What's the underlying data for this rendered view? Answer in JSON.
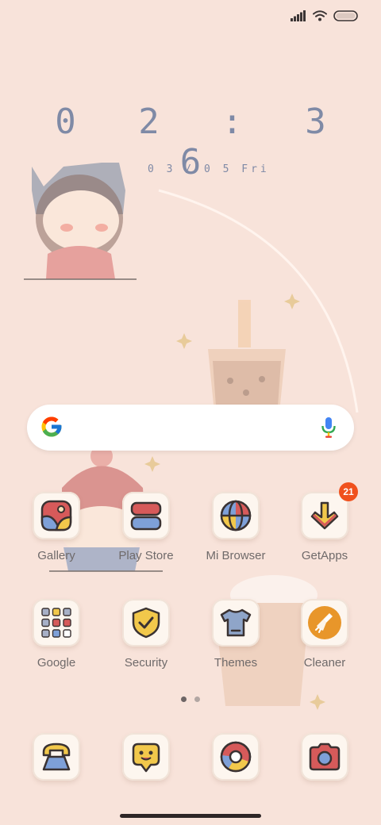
{
  "clock": {
    "time": "0 2 : 3 6",
    "date": "0 3 / 0 5  Fri"
  },
  "status": {
    "signal_icon": "signal-icon",
    "wifi_icon": "wifi-icon",
    "battery_icon": "battery-icon"
  },
  "search": {
    "logo_icon": "google-g-icon",
    "mic_icon": "mic-icon"
  },
  "apps_row1": [
    {
      "label": "Gallery",
      "icon": "gallery-icon"
    },
    {
      "label": "Play Store",
      "icon": "play-store-icon"
    },
    {
      "label": "Mi Browser",
      "icon": "browser-icon"
    },
    {
      "label": "GetApps",
      "icon": "getapps-icon",
      "badge": "21"
    }
  ],
  "apps_row2": [
    {
      "label": "Google",
      "icon": "google-folder-icon"
    },
    {
      "label": "Security",
      "icon": "security-icon"
    },
    {
      "label": "Themes",
      "icon": "themes-icon"
    },
    {
      "label": "Cleaner",
      "icon": "cleaner-icon"
    }
  ],
  "dock": [
    {
      "icon": "phone-icon"
    },
    {
      "icon": "messages-icon"
    },
    {
      "icon": "chrome-icon"
    },
    {
      "icon": "camera-icon"
    }
  ],
  "colors": {
    "background": "#f8e3da",
    "clock": "#7f8aa6",
    "badge": "#f0511d"
  },
  "pages": {
    "count": 2,
    "active": 1
  }
}
